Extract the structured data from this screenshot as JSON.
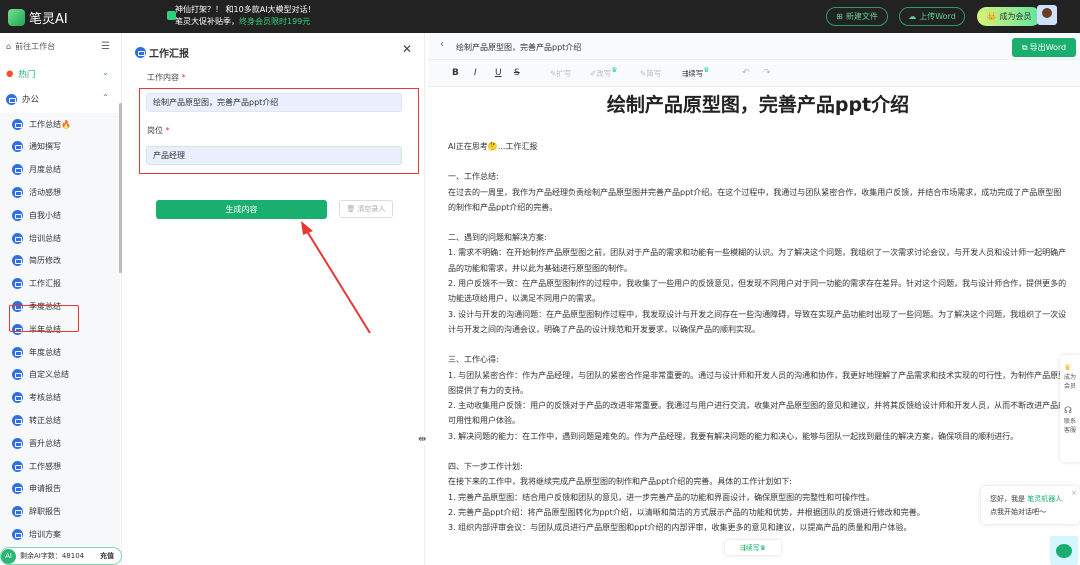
{
  "topbar": {
    "brand": "笔灵AI",
    "promo_line1": "神仙打架？！ 和10多款AI大模型对话！",
    "promo_line2": "笔灵大促补贴季，",
    "promo_highlight": "终身会员限时199元",
    "new_file": "新建文件",
    "upload_word": "上传Word",
    "become_vip": "成为会员"
  },
  "sidebar": {
    "home": "前往工作台",
    "hot": "热门",
    "office": "办公",
    "items": [
      "工作总结🔥",
      "通知撰写",
      "月度总结",
      "活动感想",
      "自我小结",
      "培训总结",
      "简历修改",
      "工作汇报",
      "季度总结",
      "半年总结",
      "年度总结",
      "自定义总结",
      "考核总结",
      "转正总结",
      "晋升总结",
      "工作感想",
      "申请报告",
      "辞职报告",
      "培训方案"
    ],
    "credits_label": "剩余AI字数：48104",
    "recharge": "充值",
    "ai_badge": "AI"
  },
  "form": {
    "title": "工作汇报",
    "content_label": "工作内容",
    "content_value": "绘制产品原型图，完善产品ppt介绍",
    "position_label": "岗位",
    "position_value": "产品经理",
    "required_mark": "*",
    "generate": "生成内容",
    "clear": "清空录入"
  },
  "editor": {
    "doc_title": "绘制产品原型图，完善产品ppt介绍",
    "export": "导出Word",
    "toolbar": {
      "bold": "B",
      "italic": "I",
      "underline": "U",
      "strike": "S",
      "expand": "扩写",
      "rewrite": "改写",
      "simplify": "简写",
      "continue": "续写",
      "undo": "↶",
      "redo": "↷"
    },
    "heading": "绘制产品原型图，完善产品ppt介绍",
    "thinking": "AI正在思考🤔...工作汇报",
    "paragraphs": [
      "",
      "一、工作总结:",
      "在过去的一周里，我作为产品经理负责绘制产品原型图并完善产品ppt介绍。在这个过程中，我通过与团队紧密合作，收集用户反馈，并结合市场需求，成功完成了产品原型图的制作和产品ppt介绍的完善。",
      "",
      "二、遇到的问题和解决方案:",
      "1. 需求不明确：在开始制作产品原型图之前，团队对于产品的需求和功能有一些模糊的认识。为了解决这个问题，我组织了一次需求讨论会议，与开发人员和设计师一起明确产品的功能和需求，并以此为基础进行原型图的制作。",
      "2. 用户反馈不一致：在产品原型图制作的过程中，我收集了一些用户的反馈意见，但发现不同用户对于同一功能的需求存在差异。针对这个问题，我与设计师合作，提供更多的功能选项给用户，以满足不同用户的需求。",
      "3. 设计与开发的沟通问题：在产品原型图制作过程中，我发现设计与开发之间存在一些沟通障碍，导致在实现产品功能时出现了一些问题。为了解决这个问题，我组织了一次设计与开发之间的沟通会议，明确了产品的设计规范和开发要求，以确保产品的顺利实现。",
      "",
      "三、工作心得:",
      "1. 与团队紧密合作：作为产品经理，与团队的紧密合作是非常重要的。通过与设计师和开发人员的沟通和协作，我更好地理解了产品需求和技术实现的可行性，为制作产品原型图提供了有力的支持。",
      "2. 主动收集用户反馈：用户的反馈对于产品的改进非常重要。我通过与用户进行交流，收集对产品原型图的意见和建议，并将其反馈给设计师和开发人员，从而不断改进产品的可用性和用户体验。",
      "3. 解决问题的能力：在工作中，遇到问题是难免的。作为产品经理，我要有解决问题的能力和决心，能够与团队一起找到最佳的解决方案，确保项目的顺利进行。",
      "",
      "四、下一步工作计划:",
      "在接下来的工作中，我将继续完成产品原型图的制作和产品ppt介绍的完善。具体的工作计划如下:",
      "1. 完善产品原型图：结合用户反馈和团队的意见，进一步完善产品的功能和界面设计，确保原型图的完整性和可操作性。",
      "2. 完善产品ppt介绍：将产品原型图转化为ppt介绍，以清晰和简洁的方式展示产品的功能和优势，并根据团队的反馈进行修改和完善。",
      "3. 组织内部评审会议：与团队成员进行产品原型图和ppt介绍的内部评审，收集更多的意见和建议，以提高产品的质量和用户体验。"
    ],
    "float_continue": "续写"
  },
  "side_panel": {
    "vip": "成为会员",
    "service": "联系客服"
  },
  "chatbot": {
    "greeting": "您好，我是",
    "name": "笔灵机器人",
    "prompt": "点我开始对话吧～",
    "close": "×"
  },
  "colors": {
    "accent": "#1aaf6e",
    "highlight": "#e53935",
    "topbar": "#222222"
  }
}
